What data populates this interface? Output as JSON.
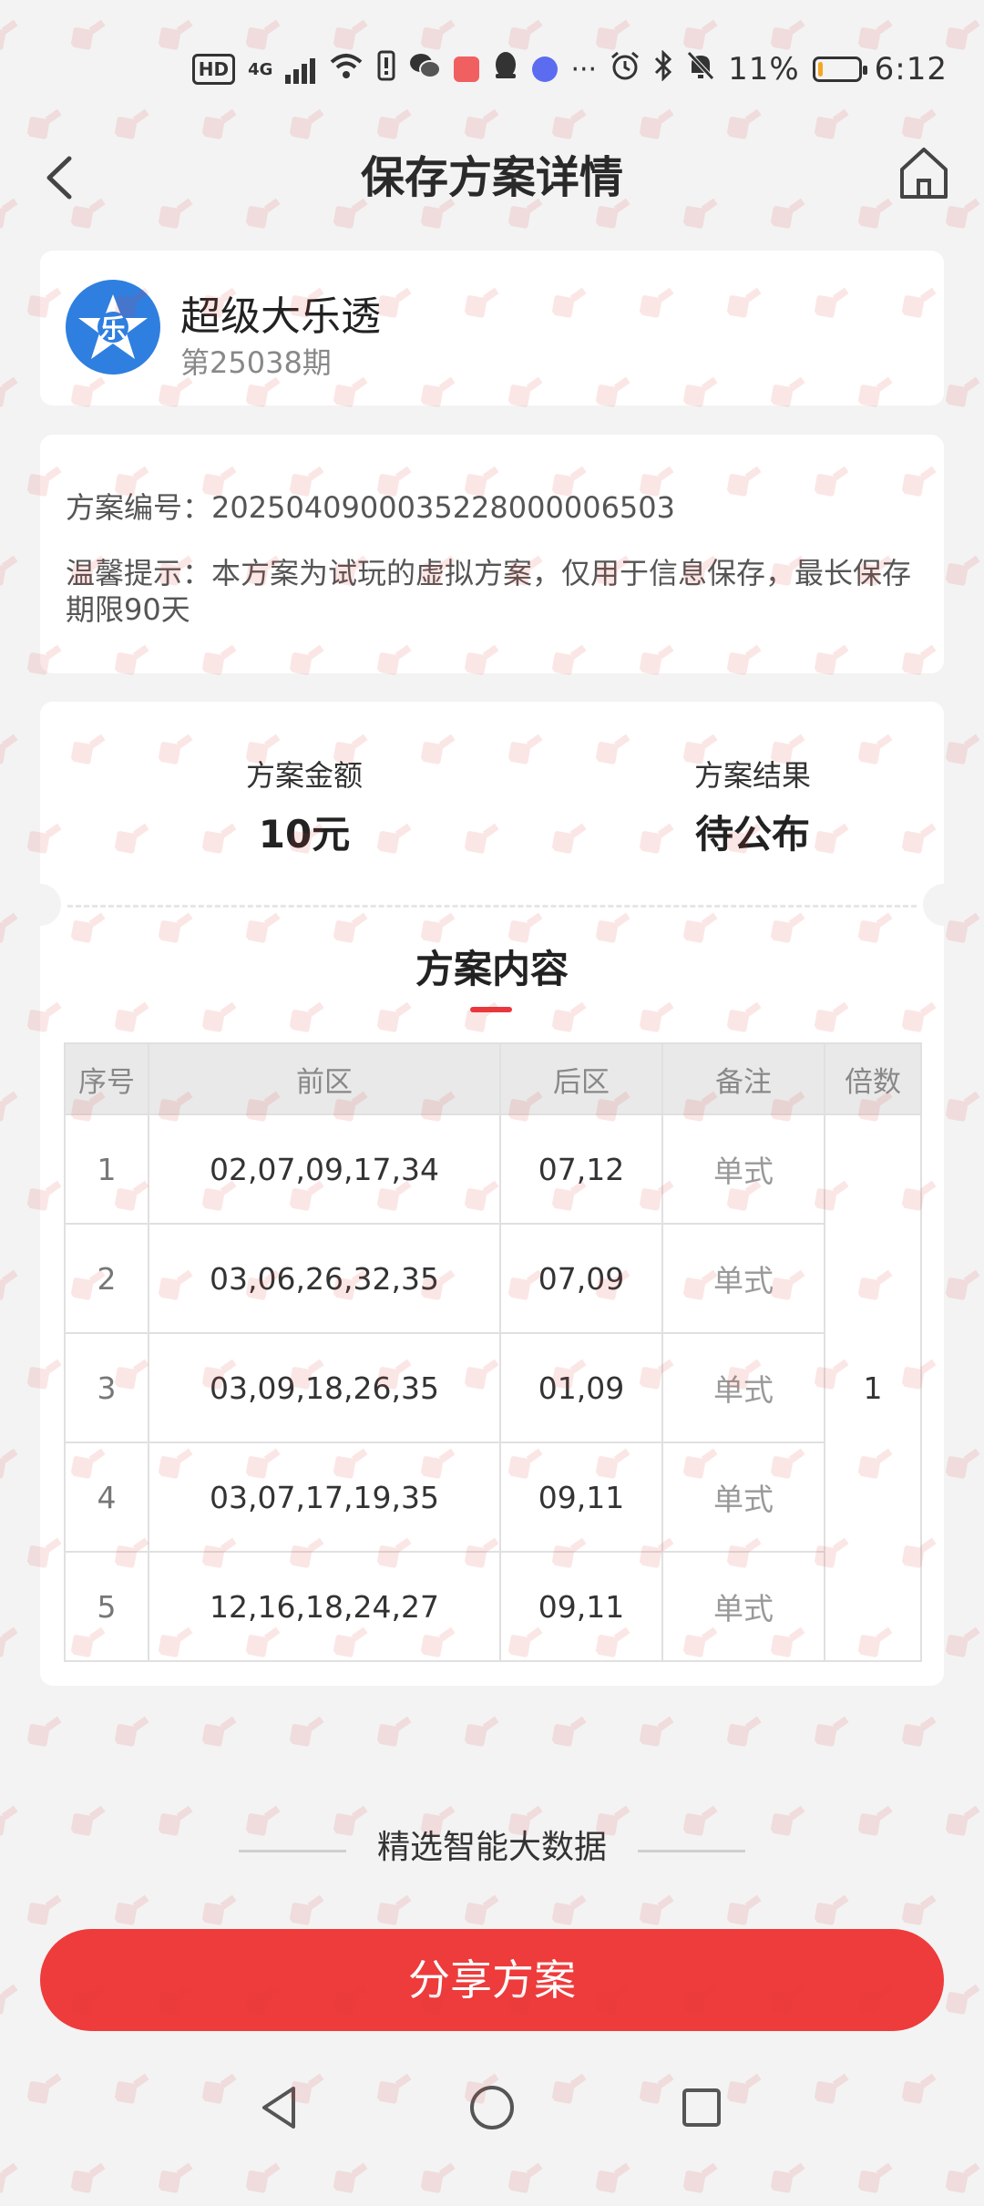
{
  "status_bar": {
    "network_badge": "HD",
    "network_type": "4G",
    "battery_percent": "11%",
    "time": "6:12",
    "battery_level": 0.11,
    "colors": {
      "battery": "#f5a623"
    }
  },
  "header": {
    "title": "保存方案详情",
    "back_icon": "chevron-left-icon",
    "home_icon": "home-icon"
  },
  "game": {
    "name": "超级大乐透",
    "issue": "第25038期",
    "logo_char": "乐",
    "logo_color": "#2f7fe0"
  },
  "info": {
    "plan_number_label": "方案编号：",
    "plan_number": "2025040900035228000006503",
    "tip_label": "温馨提示：",
    "tip_text": "本方案为试玩的虚拟方案，仅用于信息保存，最长保存期限90天"
  },
  "summary": {
    "amount_label": "方案金额",
    "amount_value": "10元",
    "result_label": "方案结果",
    "result_value": "待公布"
  },
  "content": {
    "title": "方案内容",
    "accent_color": "#e8383d",
    "columns": [
      "序号",
      "前区",
      "后区",
      "备注",
      "倍数"
    ],
    "multiplier": "1",
    "rows": [
      {
        "index": "1",
        "front": "02,07,09,17,34",
        "back": "07,12",
        "note": "单式"
      },
      {
        "index": "2",
        "front": "03,06,26,32,35",
        "back": "07,09",
        "note": "单式"
      },
      {
        "index": "3",
        "front": "03,09,18,26,35",
        "back": "01,09",
        "note": "单式"
      },
      {
        "index": "4",
        "front": "03,07,17,19,35",
        "back": "09,11",
        "note": "单式"
      },
      {
        "index": "5",
        "front": "12,16,18,24,27",
        "back": "09,11",
        "note": "单式"
      }
    ]
  },
  "section_divider": {
    "label": "精选智能大数据"
  },
  "share_button": {
    "label": "分享方案",
    "color": "#ee3b3b"
  },
  "nav": {
    "back_icon": "triangle-back-icon",
    "home_icon": "circle-home-icon",
    "recents_icon": "square-recents-icon"
  }
}
